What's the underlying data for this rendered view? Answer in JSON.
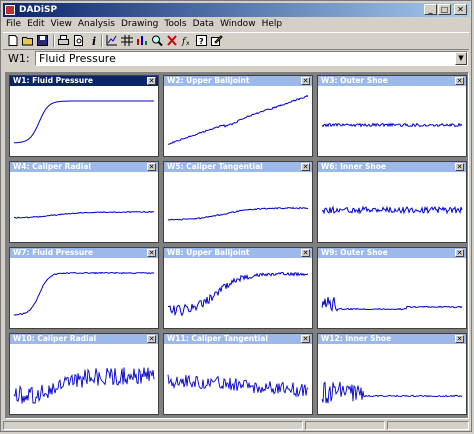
{
  "app": {
    "title": "DADiSP"
  },
  "title_buttons": {
    "minimize": "_",
    "maximize": "□",
    "close": "✕"
  },
  "menu": [
    "File",
    "Edit",
    "View",
    "Analysis",
    "Drawing",
    "Tools",
    "Data",
    "Window",
    "Help"
  ],
  "toolbar": [
    "new-icon",
    "open-icon",
    "save-icon",
    "print-icon",
    "print-preview-icon",
    "info-icon",
    "graph-icon",
    "table-icon",
    "bar-chart-icon",
    "zoom-icon",
    "delete-icon",
    "function-icon",
    "help-icon",
    "edit-icon"
  ],
  "window_selector": {
    "label": "W1:",
    "value": "Fluid Pressure"
  },
  "windows": [
    {
      "title": "W1: Fluid Pressure",
      "active": true
    },
    {
      "title": "W2: Upper Balljoint",
      "active": false
    },
    {
      "title": "W3: Outer Shoe",
      "active": false
    },
    {
      "title": "W4: Caliper Radial",
      "active": false
    },
    {
      "title": "W5: Caliper Tangential",
      "active": false
    },
    {
      "title": "W6: Inner Shoe",
      "active": false
    },
    {
      "title": "W7: Fluid Pressure",
      "active": false
    },
    {
      "title": "W8: Upper Balljoint",
      "active": false
    },
    {
      "title": "W9: Outer Shoe",
      "active": false
    },
    {
      "title": "W10: Caliper Radial",
      "active": false
    },
    {
      "title": "W11: Caliper Tangential",
      "active": false
    },
    {
      "title": "W12: Inner Shoe",
      "active": false
    }
  ],
  "colors": {
    "plot_line": "#0000cc",
    "active_title": "#0a246a",
    "inactive_title": "#9db9ea"
  }
}
